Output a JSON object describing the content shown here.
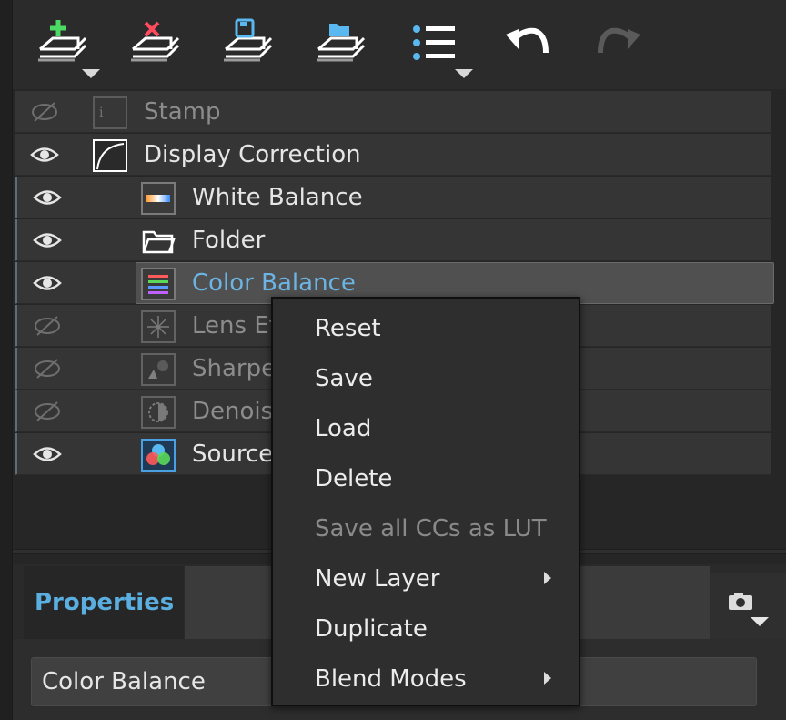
{
  "toolbar": {
    "buttons": [
      {
        "name": "add-layer",
        "icon": "layers-plus-icon",
        "has_dropdown": true
      },
      {
        "name": "delete-layer",
        "icon": "layers-x-icon",
        "has_dropdown": false
      },
      {
        "name": "save-layers",
        "icon": "layers-save-icon",
        "has_dropdown": false
      },
      {
        "name": "open-layers",
        "icon": "layers-folder-icon",
        "has_dropdown": false
      },
      {
        "name": "list-view",
        "icon": "list-icon",
        "has_dropdown": true
      },
      {
        "name": "undo",
        "icon": "undo-icon",
        "has_dropdown": false
      },
      {
        "name": "redo",
        "icon": "redo-icon",
        "enabled": false
      }
    ]
  },
  "layers": [
    {
      "label": "Stamp",
      "icon": "info-icon",
      "visible": false,
      "enabled": false,
      "level": 0
    },
    {
      "label": "Display Correction",
      "icon": "curve-icon",
      "visible": true,
      "enabled": true,
      "level": 0
    },
    {
      "label": "White Balance",
      "icon": "white-balance-icon",
      "visible": true,
      "enabled": true,
      "level": 1
    },
    {
      "label": "Folder",
      "icon": "folder-icon",
      "visible": true,
      "enabled": true,
      "level": 1
    },
    {
      "label": "Color Balance",
      "icon": "color-balance-icon",
      "visible": true,
      "enabled": true,
      "level": 1,
      "selected": true
    },
    {
      "label": "Lens Ef",
      "icon": "lens-effect-icon",
      "visible": false,
      "enabled": false,
      "level": 1
    },
    {
      "label": "Sharpe",
      "icon": "sharpen-icon",
      "visible": false,
      "enabled": false,
      "level": 1
    },
    {
      "label": "Denois",
      "icon": "denoise-icon",
      "visible": false,
      "enabled": false,
      "level": 1
    },
    {
      "label": "Source",
      "icon": "source-icon",
      "visible": true,
      "enabled": true,
      "level": 1
    }
  ],
  "properties": {
    "tab_label": "Properties",
    "camera_icon": "camera-icon",
    "name_value": "Color Balance"
  },
  "context_menu": {
    "items": [
      {
        "label": "Reset",
        "enabled": true,
        "submenu": false
      },
      {
        "label": "Save",
        "enabled": true,
        "submenu": false
      },
      {
        "label": "Load",
        "enabled": true,
        "submenu": false
      },
      {
        "label": "Delete",
        "enabled": true,
        "submenu": false
      },
      {
        "label": "Save all CCs as LUT",
        "enabled": false,
        "submenu": false
      },
      {
        "label": "New Layer",
        "enabled": true,
        "submenu": true
      },
      {
        "label": "Duplicate",
        "enabled": true,
        "submenu": false
      },
      {
        "label": "Blend Modes",
        "enabled": true,
        "submenu": true
      }
    ]
  },
  "colors": {
    "accent": "#5aaee0",
    "selected_text": "#6cb4e4",
    "add_green": "#4cd964",
    "delete_red": "#ff4b5c",
    "save_blue": "#5ab8f0"
  }
}
